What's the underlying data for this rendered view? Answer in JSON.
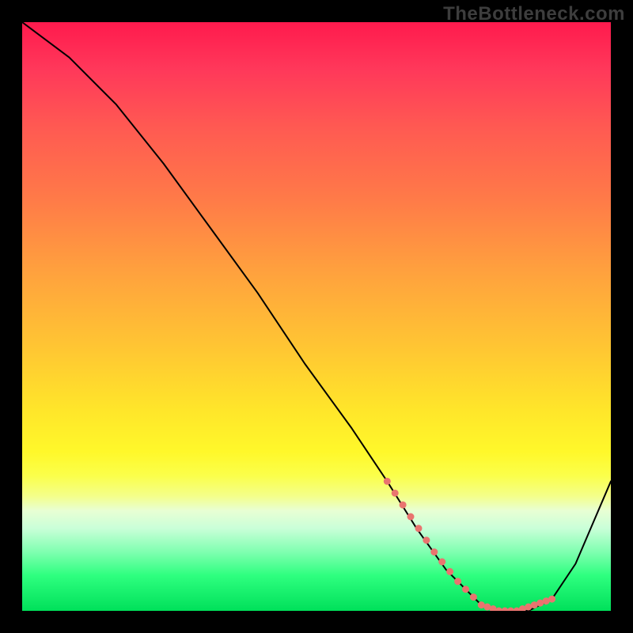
{
  "watermark": "TheBottleneck.com",
  "chart_data": {
    "type": "line",
    "title": "",
    "xlabel": "",
    "ylabel": "",
    "x_range": [
      0,
      100
    ],
    "y_range": [
      0,
      100
    ],
    "grid": false,
    "legend": false,
    "note": "Axes have no visible tick labels; x/y values are in percent of plot width/height (y = 0 at bottom).",
    "series": [
      {
        "name": "main-curve",
        "color": "#000000",
        "stroke_width": 2,
        "x": [
          0,
          4,
          8,
          16,
          24,
          32,
          40,
          48,
          56,
          62,
          67,
          72,
          78,
          82,
          86,
          90,
          94,
          100
        ],
        "y": [
          100,
          97,
          94,
          86,
          76,
          65,
          54,
          42,
          31,
          22,
          14,
          7,
          1,
          0,
          0,
          2,
          8,
          22
        ]
      },
      {
        "name": "highlight-valley",
        "color": "#e9746f",
        "stroke_width": 9,
        "dotted": true,
        "x": [
          62,
          66,
          70,
          74,
          78,
          81,
          84,
          87,
          90
        ],
        "y": [
          22,
          16,
          10,
          5,
          1,
          0,
          0,
          1,
          2
        ]
      }
    ],
    "background_gradient": {
      "direction": "vertical",
      "stops": [
        {
          "pos": 0.0,
          "color": "#ff1a4d"
        },
        {
          "pos": 0.3,
          "color": "#ff7a48"
        },
        {
          "pos": 0.55,
          "color": "#ffc533"
        },
        {
          "pos": 0.73,
          "color": "#fff82a"
        },
        {
          "pos": 0.83,
          "color": "#e8ffd4"
        },
        {
          "pos": 0.94,
          "color": "#2eff7f"
        },
        {
          "pos": 1.0,
          "color": "#00e05a"
        }
      ]
    }
  }
}
